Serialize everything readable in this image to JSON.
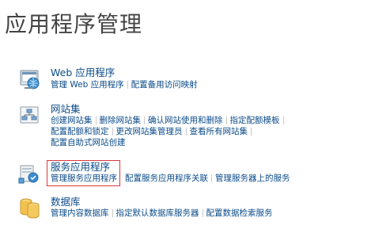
{
  "page": {
    "title": "应用程序管理"
  },
  "sections": [
    {
      "title": "Web 应用程序",
      "icon": "web-app-icon",
      "rows": [
        [
          "管理 Web 应用程序",
          "配置备用访问映射"
        ]
      ]
    },
    {
      "title": "网站集",
      "icon": "site-collection-icon",
      "rows": [
        [
          "创建网站集",
          "删除网站集",
          "确认网站使用和删除",
          "指定配额模板"
        ],
        [
          "配置配额和锁定",
          "更改网站集管理员",
          "查看所有网站集"
        ],
        [
          "配置自助式网站创建"
        ]
      ]
    },
    {
      "title": "服务应用程序",
      "icon": "service-application-icon",
      "rows": [
        [
          "管理服务应用程序",
          "配置服务应用程序关联",
          "管理服务器上的服务"
        ]
      ]
    },
    {
      "title": "数据库",
      "icon": "database-icon",
      "rows": [
        [
          "管理内容数据库",
          "指定默认数据库服务器",
          "配置数据检索服务"
        ]
      ]
    }
  ],
  "colors": {
    "link": "#0b4b8a",
    "title": "#444444",
    "highlight": "#d9383c"
  }
}
